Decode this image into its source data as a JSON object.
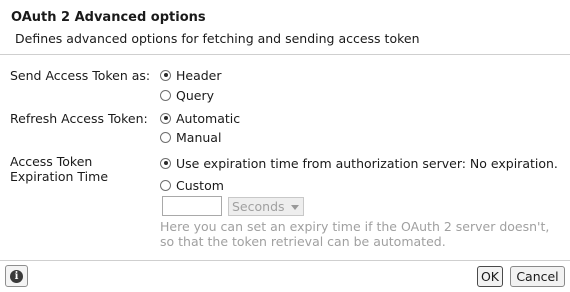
{
  "header": {
    "title": "OAuth 2 Advanced options",
    "subtitle": "Defines advanced options for fetching and sending access token"
  },
  "send_token": {
    "label": "Send Access Token as:",
    "options": [
      {
        "label": "Header",
        "checked": true
      },
      {
        "label": "Query",
        "checked": false
      }
    ]
  },
  "refresh_token": {
    "label": "Refresh Access Token:",
    "options": [
      {
        "label": "Automatic",
        "checked": true
      },
      {
        "label": "Manual",
        "checked": false
      }
    ]
  },
  "expiration": {
    "label_line1": "Access Token",
    "label_line2": "Expiration Time",
    "options": [
      {
        "label": "Use expiration time from authorization server: No expiration.",
        "checked": true
      },
      {
        "label": "Custom",
        "checked": false
      }
    ],
    "custom_value": "",
    "unit_selected": "Seconds",
    "hint_line1": "Here you can set an expiry time if the OAuth 2 server doesn't,",
    "hint_line2": "so that the token retrieval can be automated."
  },
  "footer": {
    "info_icon": "info-icon",
    "ok_label": "OK",
    "cancel_label": "Cancel"
  }
}
